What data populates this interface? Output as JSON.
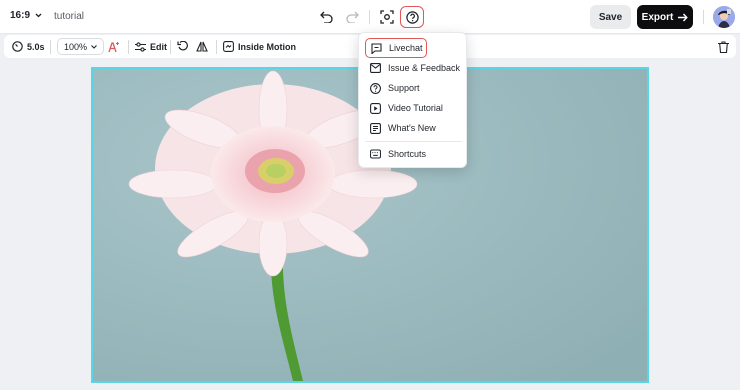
{
  "header": {
    "aspect_ratio": "16:9",
    "project_title": "tutorial",
    "save_label": "Save",
    "export_label": "Export"
  },
  "toolbar": {
    "duration": "5.0s",
    "zoom": "100%",
    "edit_label": "Edit",
    "inside_motion_label": "Inside Motion"
  },
  "help_menu": {
    "items": [
      {
        "label": "Livechat",
        "icon": "chat-icon"
      },
      {
        "label": "Issue & Feedback",
        "icon": "mail-icon"
      },
      {
        "label": "Support",
        "icon": "question-icon"
      },
      {
        "label": "Video Tutorial",
        "icon": "video-icon"
      },
      {
        "label": "What's New",
        "icon": "news-icon"
      },
      {
        "label": "Shortcuts",
        "icon": "keyboard-icon"
      }
    ]
  },
  "colors": {
    "accent_highlight": "#e15656",
    "selection_border": "#57d6e6",
    "export_bg": "#0d0d0f"
  }
}
